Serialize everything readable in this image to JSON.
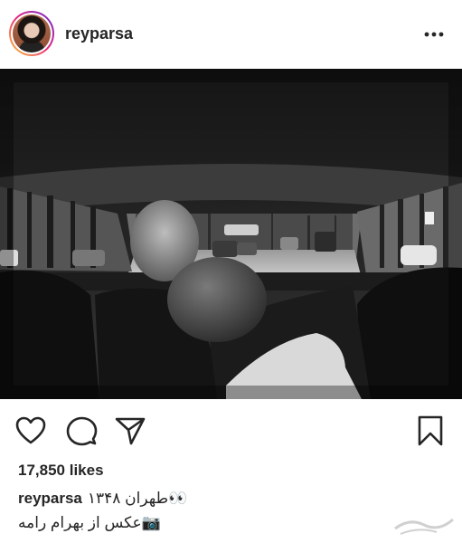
{
  "post": {
    "username": "reyparsa",
    "likes_text": "17,850 likes",
    "caption": {
      "username": "reyparsa",
      "line1": "👀طهران ۱۳۴۸",
      "line2": "📷عکس  از بهرام رامه"
    }
  },
  "icons": {
    "more": "more-options-icon",
    "like": "heart-icon",
    "comment": "comment-icon",
    "share": "share-icon",
    "save": "bookmark-icon"
  },
  "colors": {
    "text": "#262626",
    "background": "#ffffff",
    "photo": "#111111"
  }
}
